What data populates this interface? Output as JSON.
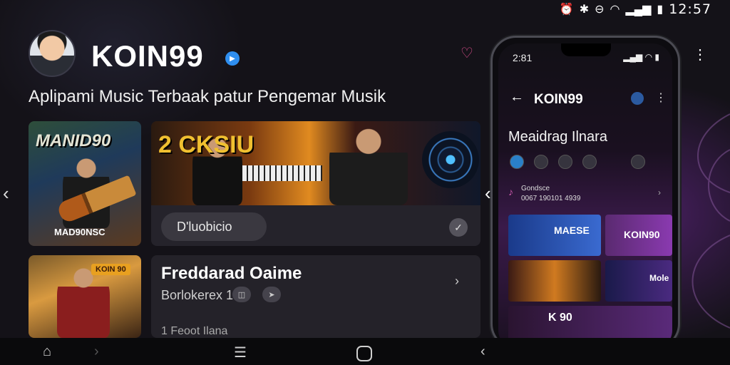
{
  "status_bar": {
    "icons": [
      "alarm-icon",
      "bluetooth-icon",
      "dnd-icon",
      "wifi-icon",
      "signal-icon",
      "battery-icon"
    ],
    "time": "12:57"
  },
  "header": {
    "brand": "KOIN99",
    "tagline": "Aplipami Music Terbaak patur Pengemar Musik"
  },
  "cards": {
    "art1_title": "MANID90",
    "art1_sub": "MAD90NSC",
    "art2_title": "2 CKSIU",
    "pill_label": "D'luobicio",
    "art3_badge": "KOIN 90",
    "panel2": {
      "title": "Freddarad Oaime",
      "subtitle": "Borlokerex 1",
      "footer": "1 Feoot Ilana"
    }
  },
  "phone": {
    "time": "2:81",
    "title": "KOIN99",
    "heading": "Meaidrag Ilnara",
    "row_line1": "Gondsce",
    "row_line2": "0067 190101 4939",
    "tile1_text": "MAESE",
    "tile2_text": "KOIN90",
    "tile4_text": "Mole",
    "tile5_text": "K 90"
  },
  "colors": {
    "background": "#141218",
    "accent_purple": "#8a3ab0",
    "accent_blue": "#2f8ff0",
    "heart_pink": "#e0508f"
  }
}
